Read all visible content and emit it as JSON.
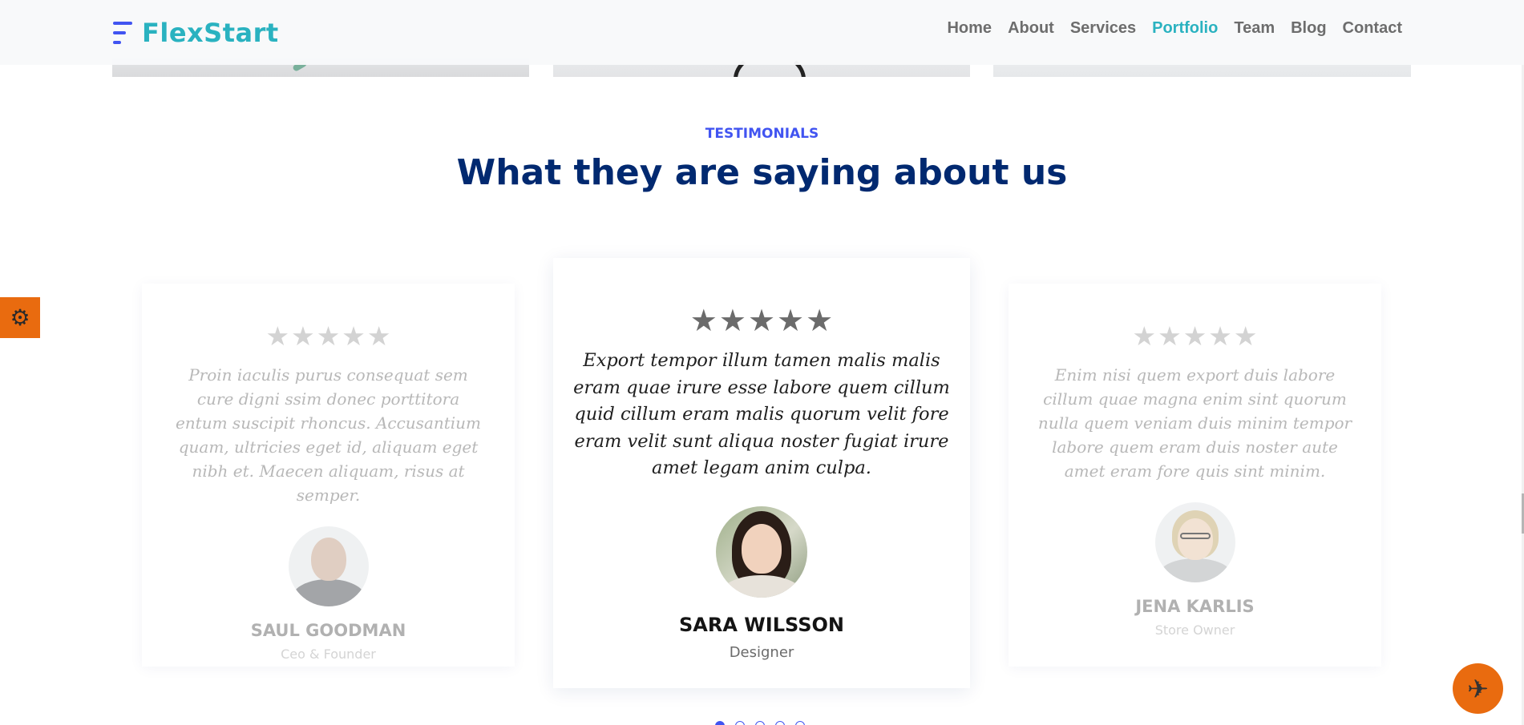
{
  "brand": {
    "name": "FlexStart"
  },
  "nav": {
    "items": [
      {
        "label": "Home",
        "active": false
      },
      {
        "label": "About",
        "active": false
      },
      {
        "label": "Services",
        "active": false
      },
      {
        "label": "Portfolio",
        "active": true
      },
      {
        "label": "Team",
        "active": false
      },
      {
        "label": "Blog",
        "active": false
      },
      {
        "label": "Contact",
        "active": false
      }
    ]
  },
  "testimonials": {
    "subtitle": "Testimonials",
    "title": "What they are saying about us",
    "rating_glyph": "★",
    "items": [
      {
        "rating": 5,
        "quote": "Proin iaculis purus consequat sem cure digni ssim donec porttitora entum suscipit rhoncus. Accusantium quam, ultricies eget id, aliquam eget nibh et. Maecen aliquam, risus at semper.",
        "name": "Saul Goodman",
        "role": "Ceo & Founder",
        "avatar": "saul-goodman-avatar"
      },
      {
        "rating": 5,
        "quote": "Export tempor illum tamen malis malis eram quae irure esse labore quem cillum quid cillum eram malis quorum velit fore eram velit sunt aliqua noster fugiat irure amet legam anim culpa.",
        "name": "Sara Wilsson",
        "role": "Designer",
        "avatar": "sara-wilsson-avatar"
      },
      {
        "rating": 5,
        "quote": "Enim nisi quem export duis labore cillum quae magna enim sint quorum nulla quem veniam duis minim tempor labore quem eram duis noster aute amet eram fore quis sint minim.",
        "name": "Jena Karlis",
        "role": "Store Owner",
        "avatar": "jena-karlis-avatar"
      }
    ],
    "pagination": {
      "count": 5,
      "active_index": 0
    }
  },
  "widgets": {
    "settings_icon": "gear-icon",
    "settings_glyph": "⚙",
    "back_to_top_icon": "airplane-icon",
    "back_to_top_glyph": "✈"
  },
  "colors": {
    "brand": "#2ab2c0",
    "accent": "#4154f1",
    "heading": "#012970",
    "widget": "#e96b0f"
  }
}
